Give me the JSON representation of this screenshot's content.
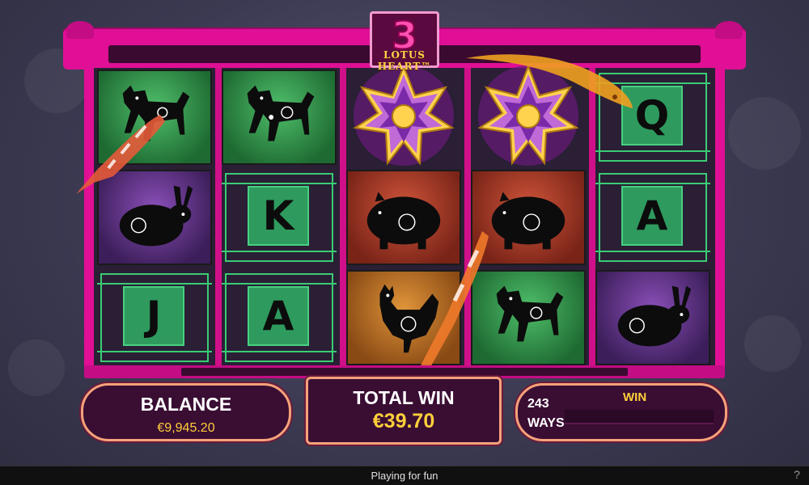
{
  "game": {
    "logo_number": "3",
    "logo_name": "LOTUS HEART™"
  },
  "reels": {
    "rows": [
      [
        "dog",
        "dog",
        "lotus",
        "lotus",
        "Q"
      ],
      [
        "rabbit",
        "K",
        "pig",
        "pig",
        "A"
      ],
      [
        "J",
        "A",
        "rooster",
        "dog",
        "rabbit"
      ]
    ],
    "letters": {
      "Q": "Q",
      "K": "K",
      "A": "A",
      "J": "J"
    }
  },
  "balance": {
    "label": "BALANCE",
    "value": "€9,945.20"
  },
  "total_win": {
    "label": "TOTAL WIN",
    "value": "€39.70"
  },
  "ways": {
    "count": "243",
    "label": "WAYS",
    "win_label": "WIN"
  },
  "status": {
    "text": "Playing for fun",
    "help": "?"
  },
  "colors": {
    "frame": "#e00f95",
    "gold": "#ffcf3a",
    "panel_border": "#f5a27a"
  }
}
